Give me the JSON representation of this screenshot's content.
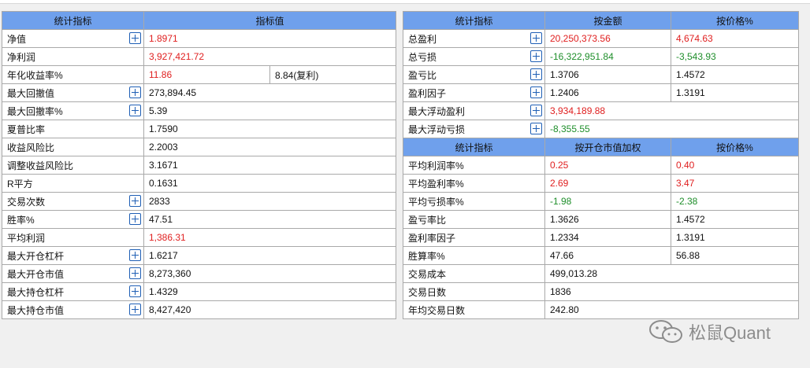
{
  "colors": {
    "header_bg": "#6fa0ec",
    "positive": "#e02020",
    "negative": "#1e8e2a",
    "plus_icon": "#1f5fb5"
  },
  "left_table": {
    "headers": [
      "统计指标",
      "指标值"
    ],
    "rows": [
      {
        "label": "净值",
        "value": "1.8971"
      },
      {
        "label": "净利润",
        "value": "3,927,421.72"
      },
      {
        "label": "年化收益率%",
        "value": "11.86",
        "value2": "8.84(复利)"
      },
      {
        "label": "最大回撤值",
        "value": "273,894.45"
      },
      {
        "label": "最大回撤率%",
        "value": "5.39"
      },
      {
        "label": "夏普比率",
        "value": "1.7590"
      },
      {
        "label": "收益风险比",
        "value": "2.2003"
      },
      {
        "label": "调整收益风险比",
        "value": "3.1671"
      },
      {
        "label": "R平方",
        "value": "0.1631"
      },
      {
        "label": "交易次数",
        "value": "2833"
      },
      {
        "label": "胜率%",
        "value": "47.51"
      },
      {
        "label": "平均利润",
        "value": "1,386.31"
      },
      {
        "label": "最大开仓杠杆",
        "value": "1.6217"
      },
      {
        "label": "最大开仓市值",
        "value": "8,273,360"
      },
      {
        "label": "最大持仓杠杆",
        "value": "1.4329"
      },
      {
        "label": "最大持仓市值",
        "value": "8,427,420"
      }
    ]
  },
  "right_table1": {
    "headers": [
      "统计指标",
      "按金额",
      "按价格%"
    ],
    "rows": [
      {
        "label": "总盈利",
        "amount": "20,250,373.56",
        "pct": "4,674.63"
      },
      {
        "label": "总亏损",
        "amount": "-16,322,951.84",
        "pct": "-3,543.93"
      },
      {
        "label": "盈亏比",
        "amount": "1.3706",
        "pct": "1.4572"
      },
      {
        "label": "盈利因子",
        "amount": "1.2406",
        "pct": "1.3191"
      },
      {
        "label": "最大浮动盈利",
        "amount": "3,934,189.88"
      },
      {
        "label": "最大浮动亏损",
        "amount": "-8,355.55"
      }
    ]
  },
  "right_table2": {
    "headers": [
      "统计指标",
      "按开仓市值加权",
      "按价格%"
    ],
    "rows": [
      {
        "label": "平均利润率%",
        "weighted": "0.25",
        "pct": "0.40"
      },
      {
        "label": "平均盈利率%",
        "weighted": "2.69",
        "pct": "3.47"
      },
      {
        "label": "平均亏损率%",
        "weighted": "-1.98",
        "pct": "-2.38"
      },
      {
        "label": "盈亏率比",
        "weighted": "1.3626",
        "pct": "1.4572"
      },
      {
        "label": "盈利率因子",
        "weighted": "1.2334",
        "pct": "1.3191"
      },
      {
        "label": "胜算率%",
        "weighted": "47.66",
        "pct": "56.88"
      },
      {
        "label": "交易成本",
        "weighted": "499,013.28"
      },
      {
        "label": "交易日数",
        "weighted": "1836"
      },
      {
        "label": "年均交易日数",
        "weighted": "242.80"
      }
    ]
  },
  "watermark": {
    "text": "松鼠Quant",
    "icon": "wechat-icon"
  }
}
